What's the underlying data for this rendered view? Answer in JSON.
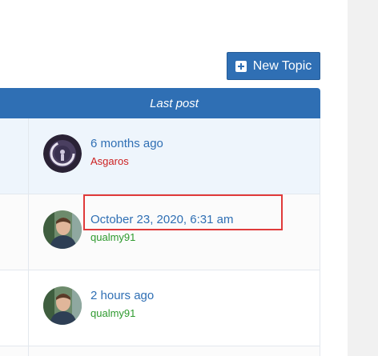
{
  "toolbar": {
    "new_topic_label": "New Topic"
  },
  "table": {
    "last_post_header": "Last post"
  },
  "rows": [
    {
      "time": "6 months ago",
      "user": "Asgaros",
      "user_color": "#cc1f1f",
      "avatar": "dark-circle-avatar"
    },
    {
      "time": "October 23, 2020, 6:31 am",
      "user": "qualmy91",
      "user_color": "#2e9a2e",
      "avatar": "person-photo-avatar"
    },
    {
      "time": "2 hours ago",
      "user": "qualmy91",
      "user_color": "#2e9a2e",
      "avatar": "person-photo-avatar"
    }
  ],
  "colors": {
    "accent": "#2f6fb4",
    "highlight": "#e03a3a"
  }
}
